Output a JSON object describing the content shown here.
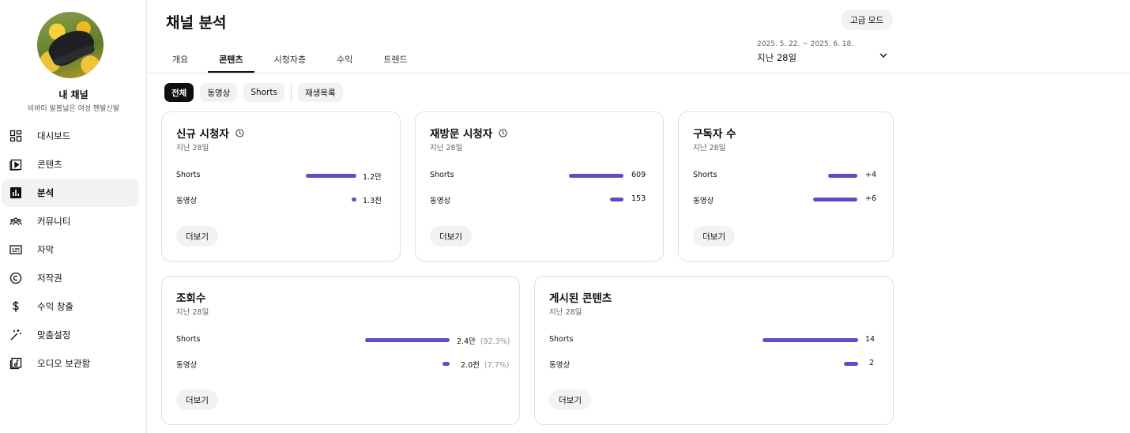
{
  "sidebar": {
    "channel_name": "내 채널",
    "channel_subtitle": "비바미 발볼넓은 여성 팬발신발",
    "items": [
      {
        "label": "대시보드",
        "icon": "dashboard-icon"
      },
      {
        "label": "콘텐츠",
        "icon": "content-icon"
      },
      {
        "label": "분석",
        "icon": "analytics-icon",
        "active": true
      },
      {
        "label": "커뮤니티",
        "icon": "community-icon"
      },
      {
        "label": "자막",
        "icon": "subtitles-icon"
      },
      {
        "label": "저작권",
        "icon": "copyright-icon"
      },
      {
        "label": "수익 창출",
        "icon": "dollar-icon"
      },
      {
        "label": "맞춤설정",
        "icon": "magic-wand-icon"
      },
      {
        "label": "오디오 보관함",
        "icon": "audio-library-icon"
      }
    ]
  },
  "header": {
    "title": "채널 분석",
    "advanced_mode": "고급 모드",
    "tabs": [
      {
        "label": "개요"
      },
      {
        "label": "콘텐츠",
        "active": true
      },
      {
        "label": "시청자층"
      },
      {
        "label": "수익"
      },
      {
        "label": "트렌드"
      }
    ],
    "date_range": "2025. 5. 22. ~ 2025. 6. 18.",
    "period": "지난 28일"
  },
  "chips": [
    {
      "label": "전체",
      "active": true
    },
    {
      "label": "동영상"
    },
    {
      "label": "Shorts"
    },
    {
      "label": "재생목록"
    }
  ],
  "cards": {
    "new_viewers": {
      "title": "신규 시청자",
      "subtitle": "지난 28일",
      "rows": [
        {
          "label": "Shorts",
          "value": "1.2만",
          "fraction": 1.0
        },
        {
          "label": "동영상",
          "value": "1.3천",
          "fraction": 0.1
        }
      ],
      "more": "더보기"
    },
    "returning_viewers": {
      "title": "재방문 시청자",
      "subtitle": "지난 28일",
      "rows": [
        {
          "label": "Shorts",
          "value": "609",
          "fraction": 1.0
        },
        {
          "label": "동영상",
          "value": "153",
          "fraction": 0.25
        }
      ],
      "more": "더보기"
    },
    "subscribers": {
      "title": "구독자 수",
      "subtitle": "지난 28일",
      "rows": [
        {
          "label": "Shorts",
          "value": "+4",
          "fraction": 0.67
        },
        {
          "label": "동영상",
          "value": "+6",
          "fraction": 1.0
        }
      ],
      "more": "더보기"
    },
    "views": {
      "title": "조회수",
      "subtitle": "지난 28일",
      "rows": [
        {
          "label": "Shorts",
          "value": "2.4만",
          "pct": "(92.3%)",
          "fraction": 1.0
        },
        {
          "label": "동영상",
          "value": "2.0천",
          "pct": "(7.7%)",
          "fraction": 0.08
        }
      ],
      "more": "더보기"
    },
    "published": {
      "title": "게시된 콘텐츠",
      "subtitle": "지난 28일",
      "rows": [
        {
          "label": "Shorts",
          "value": "14",
          "fraction": 1.0
        },
        {
          "label": "동영상",
          "value": "2",
          "fraction": 0.14
        }
      ],
      "more": "더보기"
    }
  },
  "colors": {
    "bar": "#5b4fc9",
    "active_chip": "#0f0f0f"
  }
}
